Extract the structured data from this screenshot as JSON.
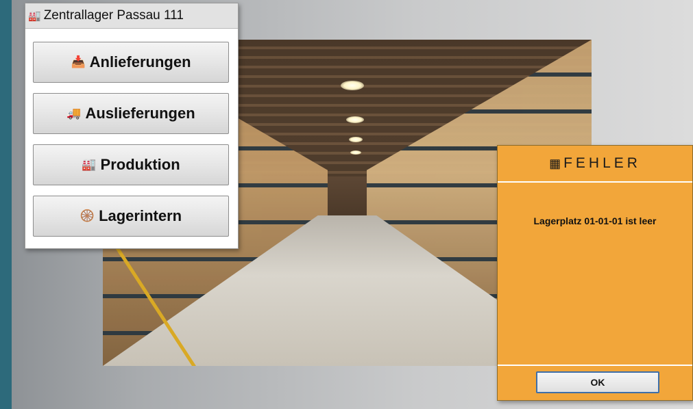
{
  "menu": {
    "title_icon": "warehouse-icon",
    "title": "Zentrallager Passau 111",
    "buttons": [
      {
        "icon": "inbound-delivery-icon",
        "label": "Anlieferungen"
      },
      {
        "icon": "outbound-delivery-icon",
        "label": "Auslieferungen"
      },
      {
        "icon": "production-icon",
        "label": "Produktion"
      },
      {
        "icon": "forklift-icon",
        "label": "Lagerintern"
      }
    ]
  },
  "dialog": {
    "title_icon": "grid-icon",
    "title": "FEHLER",
    "message": "Lagerplatz 01-01-01 ist leer",
    "ok_label": "OK"
  },
  "colors": {
    "accent_strip": "#2d6a7b",
    "dialog_background": "#f2a63a",
    "ok_border": "#3f6fa8"
  }
}
